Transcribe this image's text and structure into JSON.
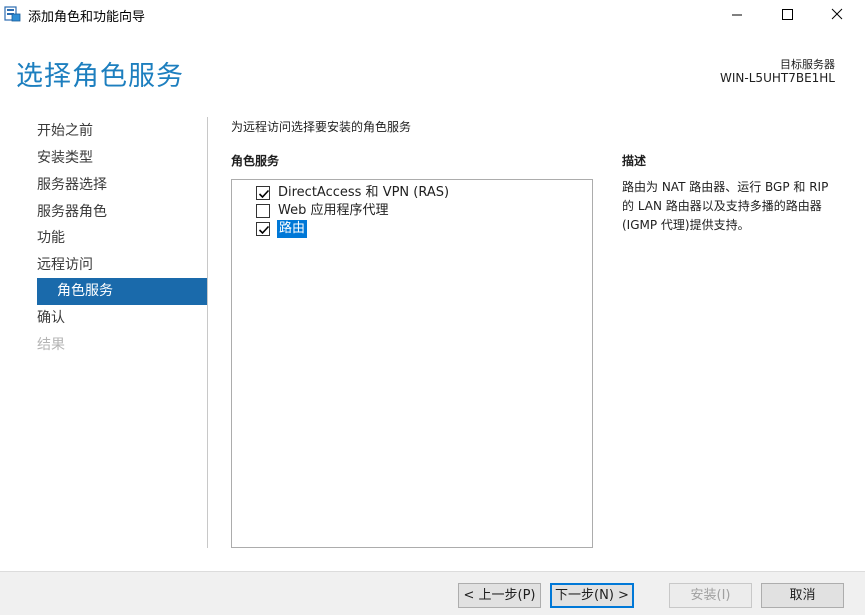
{
  "window": {
    "title": "添加角色和功能向导",
    "minimize_label": "minimize",
    "maximize_label": "maximize",
    "close_label": "close"
  },
  "header": {
    "page_title": "选择角色服务",
    "target_label": "目标服务器",
    "target_value": "WIN-L5UHT7BE1HL"
  },
  "nav": {
    "items": [
      {
        "label": "开始之前",
        "state": "normal"
      },
      {
        "label": "安装类型",
        "state": "normal"
      },
      {
        "label": "服务器选择",
        "state": "normal"
      },
      {
        "label": "服务器角色",
        "state": "normal"
      },
      {
        "label": "功能",
        "state": "normal"
      },
      {
        "label": "远程访问",
        "state": "normal"
      },
      {
        "label": "角色服务",
        "state": "active"
      },
      {
        "label": "确认",
        "state": "normal"
      },
      {
        "label": "结果",
        "state": "disabled"
      }
    ]
  },
  "main": {
    "intro": "为远程访问选择要安装的角色服务",
    "section_head": "角色服务",
    "services": [
      {
        "label": "DirectAccess 和 VPN (RAS)",
        "checked": true,
        "selected": false
      },
      {
        "label": "Web 应用程序代理",
        "checked": false,
        "selected": false
      },
      {
        "label": "路由",
        "checked": true,
        "selected": true
      }
    ]
  },
  "description": {
    "heading": "描述",
    "text": "路由为 NAT 路由器、运行 BGP 和 RIP 的 LAN 路由器以及支持多播的路由器(IGMP 代理)提供支持。"
  },
  "footer": {
    "prev_label": "< 上一步(P)",
    "next_label": "下一步(N) >",
    "install_label": "安装(I)",
    "cancel_label": "取消"
  },
  "colors": {
    "accent": "#1d7fbf",
    "nav_active_bg": "#1a6aab",
    "selection_bg": "#0078d7"
  }
}
